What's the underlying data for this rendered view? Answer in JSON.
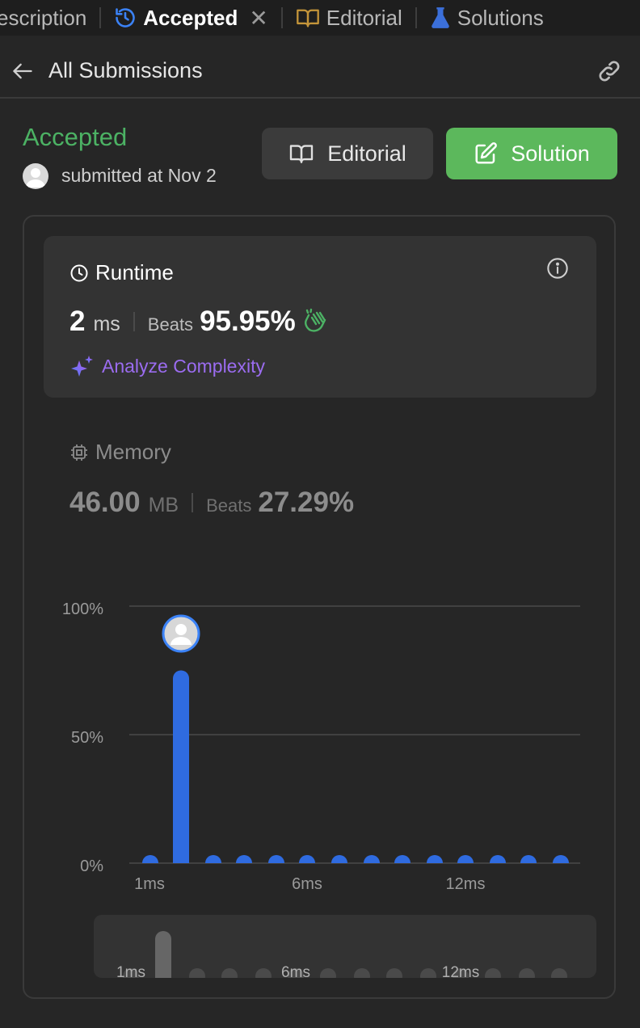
{
  "tabs": [
    {
      "label": "Description",
      "shown": "escription"
    },
    {
      "label": "Accepted"
    },
    {
      "label": "Editorial"
    },
    {
      "label": "Solutions"
    }
  ],
  "subbar": {
    "back_title": "All Submissions"
  },
  "submission": {
    "status": "Accepted",
    "submitted_text": "submitted at Nov 2"
  },
  "buttons": {
    "editorial": "Editorial",
    "solution": "Solution"
  },
  "runtime": {
    "label": "Runtime",
    "value": "2",
    "unit": "ms",
    "beats_label": "Beats",
    "beats_pct": "95.95%",
    "analyze": "Analyze Complexity"
  },
  "memory": {
    "label": "Memory",
    "value": "46.00",
    "unit": "MB",
    "beats_label": "Beats",
    "beats_pct": "27.29%"
  },
  "colors": {
    "accent_green": "#4cb264",
    "bar_blue": "#2f6be0",
    "analyze_purple": "#9b6cf0"
  },
  "chart_data": {
    "type": "bar",
    "y_ticks": [
      "100%",
      "50%",
      "0%"
    ],
    "x_tick_labels": [
      "1ms",
      "6ms",
      "12ms"
    ],
    "ylim": [
      0,
      100
    ],
    "values": [
      1,
      75,
      2,
      1,
      1,
      1,
      1,
      1,
      1,
      1,
      1,
      1,
      1,
      1
    ],
    "highlight_index": 1,
    "mini_labels": [
      "1ms",
      "6ms",
      "12ms"
    ],
    "grid": true
  }
}
